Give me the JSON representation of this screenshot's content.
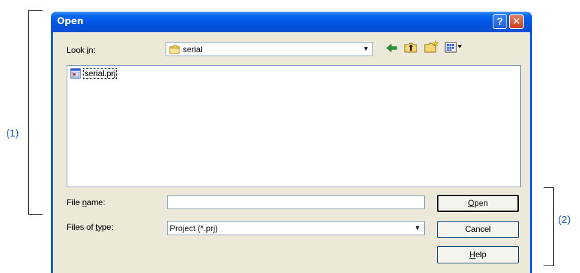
{
  "annotations": {
    "left": "(1)",
    "right": "(2)"
  },
  "dialog": {
    "title": "Open",
    "help_glyph": "?",
    "close_glyph": "✕",
    "look_in": {
      "label_pre": "Look ",
      "label_key": "i",
      "label_post": "n:",
      "value": "serial",
      "icon": "folder-icon"
    },
    "toolbar_icons": [
      "back-arrow-icon",
      "up-folder-icon",
      "new-folder-icon",
      "view-menu-icon"
    ],
    "files": [
      {
        "name": "serial.prj",
        "icon": "project-file-icon"
      }
    ],
    "file_name": {
      "label_pre": "File ",
      "label_key": "n",
      "label_post": "ame:",
      "value": ""
    },
    "files_of_type": {
      "label_pre": "Files of ",
      "label_key": "t",
      "label_post": "ype:",
      "value": "Project (*.prj)"
    },
    "buttons": {
      "open_key": "O",
      "open_rest": "pen",
      "cancel": "Cancel",
      "help_key": "H",
      "help_rest": "elp"
    }
  }
}
